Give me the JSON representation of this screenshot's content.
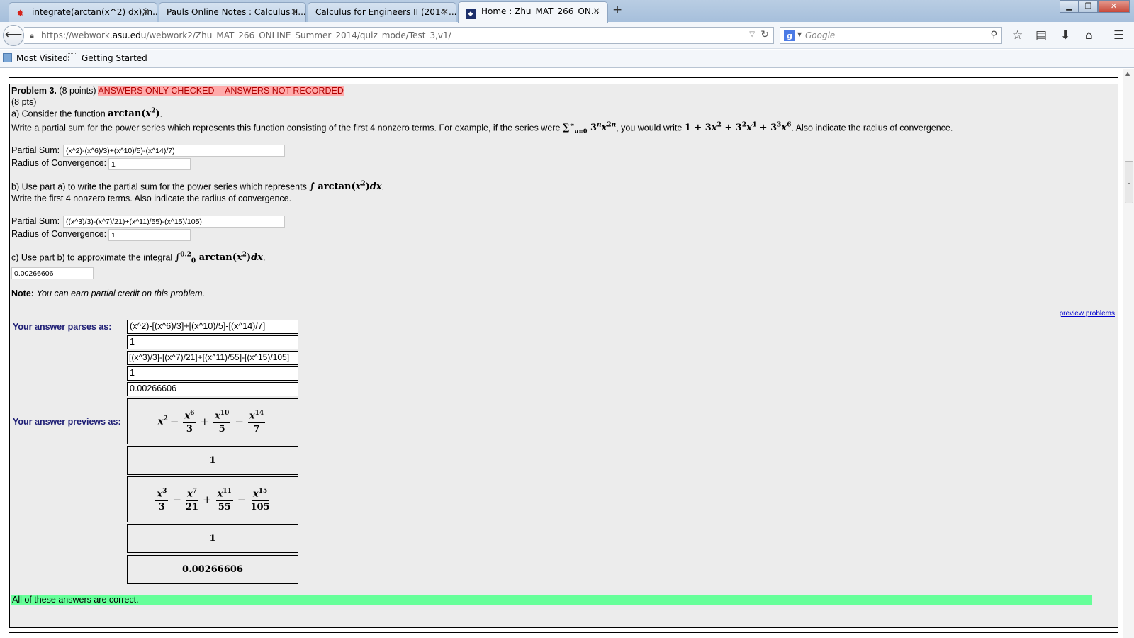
{
  "browser": {
    "tabs": [
      {
        "title": "integrate(arctan(x^2) dx),in...",
        "icon": "wolfram-icon",
        "active": false
      },
      {
        "title": "Pauls Online Notes : Calculus II...",
        "icon": "",
        "active": false
      },
      {
        "title": "Calculus for Engineers II (2014 ...",
        "icon": "",
        "active": false
      },
      {
        "title": "Home : Zhu_MAT_266_ON...",
        "icon": "webwork-icon",
        "active": true
      }
    ],
    "new_tab": "+",
    "url_host_prefix": "https://webwork.",
    "url_host": "asu.edu",
    "url_path": "/webwork2/Zhu_MAT_266_ONLINE_Summer_2014/quiz_mode/Test_3,v1/",
    "search_engine": "Google",
    "search_placeholder": "Google",
    "bookmarks": [
      "Most Visited",
      "Getting Started"
    ]
  },
  "problem": {
    "title": "Problem 3.",
    "points": "(8 points)",
    "status_warning": "ANSWERS ONLY CHECKED -- ANSWERS NOT RECORDED",
    "pts": "(8 pts)",
    "part_a_intro": "a) Consider the function",
    "part_a_instructions_1": "Write a partial sum for the power series which represents this function consisting of the first 4 nonzero terms. For example, if the series were",
    "part_a_instructions_2": ", you would write",
    "part_a_instructions_3": ". Also indicate the radius of convergence.",
    "partial_sum_label": "Partial Sum:",
    "radius_label": "Radius of Convergence:",
    "part_a_partial_sum": "(x^2)-(x^6)/3)+(x^10)/5)-(x^14)/7)",
    "part_a_radius": "1",
    "part_b_intro": "b) Use part a) to write the partial sum for the power series which represents",
    "part_b_line2": "Write the first 4 nonzero terms. Also indicate the radius of convergence.",
    "part_b_partial_sum": "((x^3)/3)-(x^7)/21)+(x^11)/55)-(x^15)/105)",
    "part_b_radius": "1",
    "part_c_intro": "c) Use part b) to approximate the integral",
    "part_c_answer": "0.00266606",
    "note_label": "Note:",
    "note_text": "You can earn partial credit on this problem.",
    "preview_link": "preview problems",
    "parses_label": "Your answer parses as:",
    "parsed": [
      "(x^2)-[(x^6)/3]+[(x^10)/5]-[(x^14)/7]",
      "1",
      "[(x^3)/3]-[(x^7)/21]+[(x^11)/55]-[(x^15)/105]",
      "1",
      "0.00266606"
    ],
    "previews_label": "Your answer previews as:",
    "preview_values": [
      "1",
      "1",
      "0.00266606"
    ],
    "result": "All of these answers are correct."
  }
}
